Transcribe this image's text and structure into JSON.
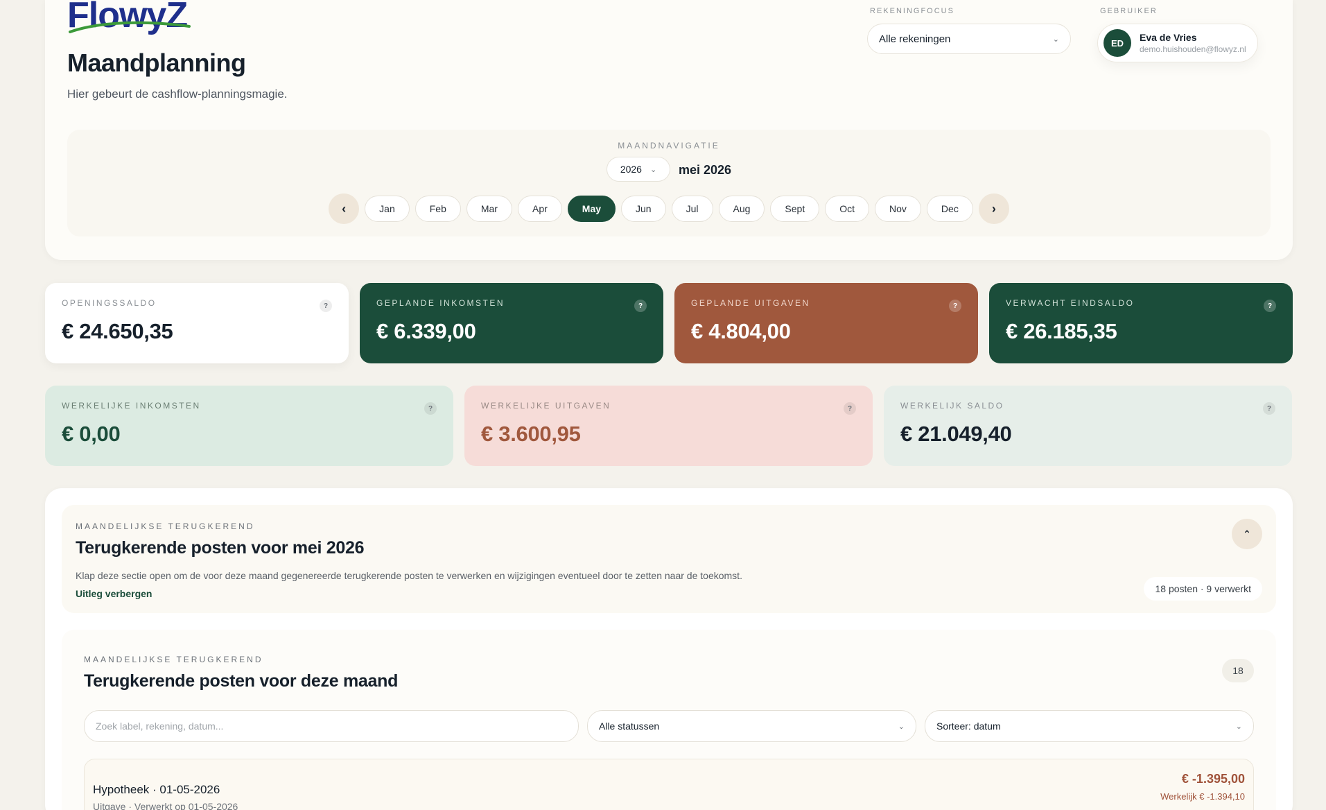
{
  "brand": {
    "logo_text": "FlowyZ"
  },
  "header": {
    "title": "Maandplanning",
    "subtitle": "Hier gebeurt de cashflow-planningsmagie.",
    "account_focus_label": "REKENINGFOCUS",
    "account_focus_value": "Alle rekeningen",
    "user_label": "GEBRUIKER",
    "user_initials": "ED",
    "user_name": "Eva de Vries",
    "user_email": "demo.huishouden@flowyz.nl"
  },
  "month_nav": {
    "label": "MAANDNAVIGATIE",
    "year": "2026",
    "current": "mei 2026",
    "prev_icon": "chevron-left-icon",
    "next_icon": "chevron-right-icon",
    "months": [
      "Jan",
      "Feb",
      "Mar",
      "Apr",
      "May",
      "Jun",
      "Jul",
      "Aug",
      "Sept",
      "Oct",
      "Nov",
      "Dec"
    ],
    "active_month": "May"
  },
  "kpis_planned": [
    {
      "label": "OPENINGSSALDO",
      "value": "€ 24.650,35",
      "bg": "#ffffff",
      "fg": "#16202b",
      "label_fg": "#8a8f94"
    },
    {
      "label": "GEPLANDE INKOMSTEN",
      "value": "€ 6.339,00",
      "bg": "#1b4d3a",
      "fg": "#ffffff",
      "label_fg": "#cfe0d6"
    },
    {
      "label": "GEPLANDE UITGAVEN",
      "value": "€ 4.804,00",
      "bg": "#a0583d",
      "fg": "#ffffff",
      "label_fg": "#f1d7cc"
    },
    {
      "label": "VERWACHT EINDSALDO",
      "value": "€ 26.185,35",
      "bg": "#1b4d3a",
      "fg": "#ffffff",
      "label_fg": "#cfe0d6"
    }
  ],
  "kpis_actual": [
    {
      "label": "WERKELIJKE INKOMSTEN",
      "value": "€ 0,00",
      "bg": "#dcebe2",
      "fg": "#1b4d3a",
      "label_fg": "#6b7f74"
    },
    {
      "label": "WERKELIJKE UITGAVEN",
      "value": "€ 3.600,95",
      "bg": "#f6dcd8",
      "fg": "#a0583d",
      "label_fg": "#9a8a86"
    },
    {
      "label": "WERKELIJK SALDO",
      "value": "€ 21.049,40",
      "bg": "#e6eee9",
      "fg": "#16202b",
      "label_fg": "#8a8f94"
    }
  ],
  "help_glyph": "?",
  "recurring": {
    "eyebrow": "MAANDELIJKSE TERUGKEREND",
    "title": "Terugkerende posten voor mei 2026",
    "description": "Klap deze sectie open om de voor deze maand gegenereerde terugkerende posten te verwerken en wijzigingen eventueel door te zetten naar de toekomst.",
    "toggle_link": "Uitleg verbergen",
    "summary": "18 posten · 9 verwerkt",
    "collapse_icon": "chevron-up-icon"
  },
  "list": {
    "eyebrow": "MAANDELIJKSE TERUGKEREND",
    "title": "Terugkerende posten voor deze maand",
    "count": "18",
    "search_placeholder": "Zoek label, rekening, datum...",
    "status_filter": "Alle statussen",
    "sort": "Sorteer: datum",
    "rows": [
      {
        "title": "Hypotheek · 01-05-2026",
        "sub": "Uitgave · Verwerkt op 01-05-2026",
        "amount": "€ -1.395,00",
        "actual": "Werkelijk € -1.394,10"
      }
    ]
  }
}
